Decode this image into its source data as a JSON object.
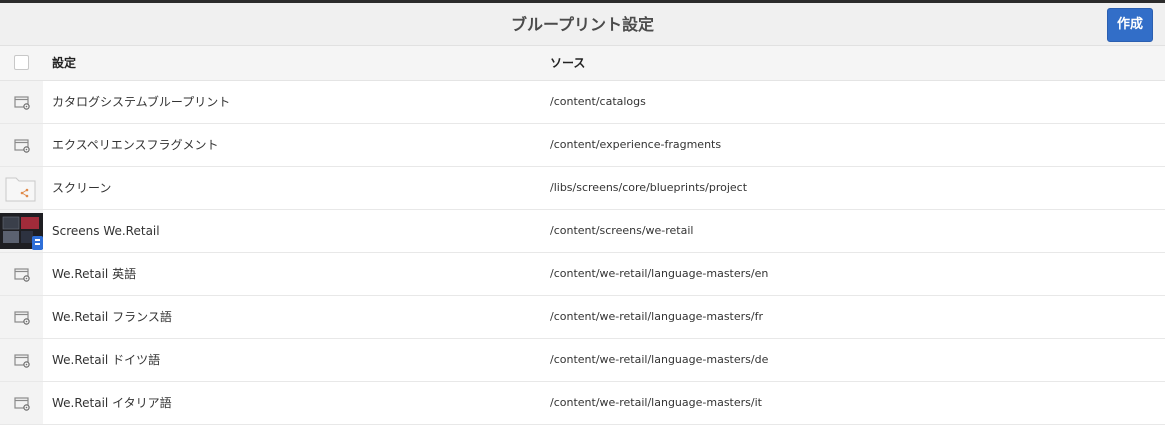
{
  "header": {
    "title": "ブループリント設定",
    "create_label": "作成"
  },
  "table": {
    "columns": {
      "setting": "設定",
      "source": "ソース"
    },
    "rows": [
      {
        "name": "カタログシステムブループリント",
        "source": "/content/catalogs",
        "icon": "blueprint-config-icon"
      },
      {
        "name": "エクスペリエンスフラグメント",
        "source": "/content/experience-fragments",
        "icon": "blueprint-config-icon"
      },
      {
        "name": "スクリーン",
        "source": "/libs/screens/core/blueprints/project",
        "icon": "folder-share-icon"
      },
      {
        "name": "Screens We.Retail",
        "source": "/content/screens/we-retail",
        "icon": "screens-thumbnail-icon"
      },
      {
        "name": "We.Retail 英語",
        "source": "/content/we-retail/language-masters/en",
        "icon": "blueprint-config-icon"
      },
      {
        "name": "We.Retail フランス語",
        "source": "/content/we-retail/language-masters/fr",
        "icon": "blueprint-config-icon"
      },
      {
        "name": "We.Retail ドイツ語",
        "source": "/content/we-retail/language-masters/de",
        "icon": "blueprint-config-icon"
      },
      {
        "name": "We.Retail イタリア語",
        "source": "/content/we-retail/language-masters/it",
        "icon": "blueprint-config-icon"
      }
    ]
  },
  "colors": {
    "accent": "#326ec8",
    "header_bg": "#f0f0f0"
  }
}
